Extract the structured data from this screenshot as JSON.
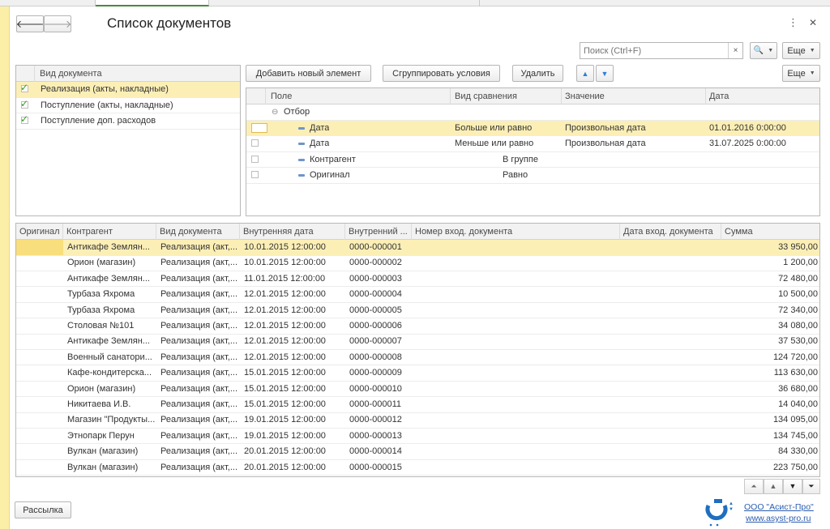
{
  "window": {
    "title": "Список документов",
    "back_label": "🡐",
    "forward_label": "🡒",
    "more_icon": "⋮",
    "close_icon": "✕"
  },
  "search": {
    "placeholder": "Поиск (Ctrl+F)",
    "clear_label": "×",
    "find_label": "🔍"
  },
  "buttons": {
    "more": "Еще",
    "add": "Добавить новый элемент",
    "group": "Сгруппировать условия",
    "delete": "Удалить",
    "up": "▲",
    "down": "▼",
    "mailing": "Рассылка"
  },
  "doc_types": {
    "header": "Вид документа",
    "items": [
      {
        "label": "Реализация (акты, накладные)",
        "checked": true
      },
      {
        "label": "Поступление (акты, накладные)",
        "checked": true
      },
      {
        "label": "Поступление доп. расходов",
        "checked": true
      }
    ]
  },
  "filter": {
    "headers": [
      "Поле",
      "Вид сравнения",
      "Значение",
      "Дата"
    ],
    "group_label": "Отбор",
    "group_toggle": "⊖",
    "rows": [
      {
        "field": "Дата",
        "comparison": "Больше или равно",
        "value": "Произвольная дата",
        "date": "01.01.2016 0:00:00"
      },
      {
        "field": "Дата",
        "comparison": "Меньше или равно",
        "value": "Произвольная дата",
        "date": "31.07.2025 0:00:00"
      },
      {
        "field": "Контрагент",
        "comparison": "В группе",
        "value": "",
        "date": ""
      },
      {
        "field": "Оригинал",
        "comparison": "Равно",
        "value": "",
        "date": ""
      }
    ]
  },
  "documents": {
    "headers": [
      "Оригинал",
      "Контрагент",
      "Вид документа",
      "Внутренняя дата",
      "Внутренний ...",
      "Номер вход. документа",
      "Дата вход. документа",
      "Сумма"
    ],
    "rows": [
      {
        "counterparty": "Антикафе Землян...",
        "type": "Реализация (акт,...",
        "date": "10.01.2015 12:00:00",
        "number": "0000-000001",
        "sum": "33 950,00"
      },
      {
        "counterparty": "Орион (магазин)",
        "type": "Реализация (акт,...",
        "date": "10.01.2015 12:00:00",
        "number": "0000-000002",
        "sum": "1 200,00"
      },
      {
        "counterparty": "Антикафе Землян...",
        "type": "Реализация (акт,...",
        "date": "11.01.2015 12:00:00",
        "number": "0000-000003",
        "sum": "72 480,00"
      },
      {
        "counterparty": "Турбаза Яхрома",
        "type": "Реализация (акт,...",
        "date": "12.01.2015 12:00:00",
        "number": "0000-000004",
        "sum": "10 500,00"
      },
      {
        "counterparty": "Турбаза Яхрома",
        "type": "Реализация (акт,...",
        "date": "12.01.2015 12:00:00",
        "number": "0000-000005",
        "sum": "72 340,00"
      },
      {
        "counterparty": "Столовая №101",
        "type": "Реализация (акт,...",
        "date": "12.01.2015 12:00:00",
        "number": "0000-000006",
        "sum": "34 080,00"
      },
      {
        "counterparty": "Антикафе Землян...",
        "type": "Реализация (акт,...",
        "date": "12.01.2015 12:00:00",
        "number": "0000-000007",
        "sum": "37 530,00"
      },
      {
        "counterparty": "Военный санатори...",
        "type": "Реализация (акт,...",
        "date": "12.01.2015 12:00:00",
        "number": "0000-000008",
        "sum": "124 720,00"
      },
      {
        "counterparty": "Кафе-кондитерска...",
        "type": "Реализация (акт,...",
        "date": "15.01.2015 12:00:00",
        "number": "0000-000009",
        "sum": "113 630,00"
      },
      {
        "counterparty": "Орион (магазин)",
        "type": "Реализация (акт,...",
        "date": "15.01.2015 12:00:00",
        "number": "0000-000010",
        "sum": "36 680,00"
      },
      {
        "counterparty": "Никитаева И.В.",
        "type": "Реализация (акт,...",
        "date": "15.01.2015 12:00:00",
        "number": "0000-000011",
        "sum": "14 040,00"
      },
      {
        "counterparty": "Магазин \"Продукты...",
        "type": "Реализация (акт,...",
        "date": "19.01.2015 12:00:00",
        "number": "0000-000012",
        "sum": "134 095,00"
      },
      {
        "counterparty": "Этнопарк Перун",
        "type": "Реализация (акт,...",
        "date": "19.01.2015 12:00:00",
        "number": "0000-000013",
        "sum": "134 745,00"
      },
      {
        "counterparty": "Вулкан (магазин)",
        "type": "Реализация (акт,...",
        "date": "20.01.2015 12:00:00",
        "number": "0000-000014",
        "sum": "84 330,00"
      },
      {
        "counterparty": "Вулкан (магазин)",
        "type": "Реализация (акт,...",
        "date": "20.01.2015 12:00:00",
        "number": "0000-000015",
        "sum": "223 750,00"
      }
    ]
  },
  "pager": {
    "first": "⏶",
    "prev": "▲",
    "next": "▼",
    "last": "⏷"
  },
  "footer": {
    "company": "ООО \"Асист-Про\"",
    "site": "www.asyst-pro.ru"
  },
  "colors": {
    "selection": "#fcefb6",
    "accent_blue": "#2f7fd8",
    "check_green": "#3a9a2a"
  }
}
